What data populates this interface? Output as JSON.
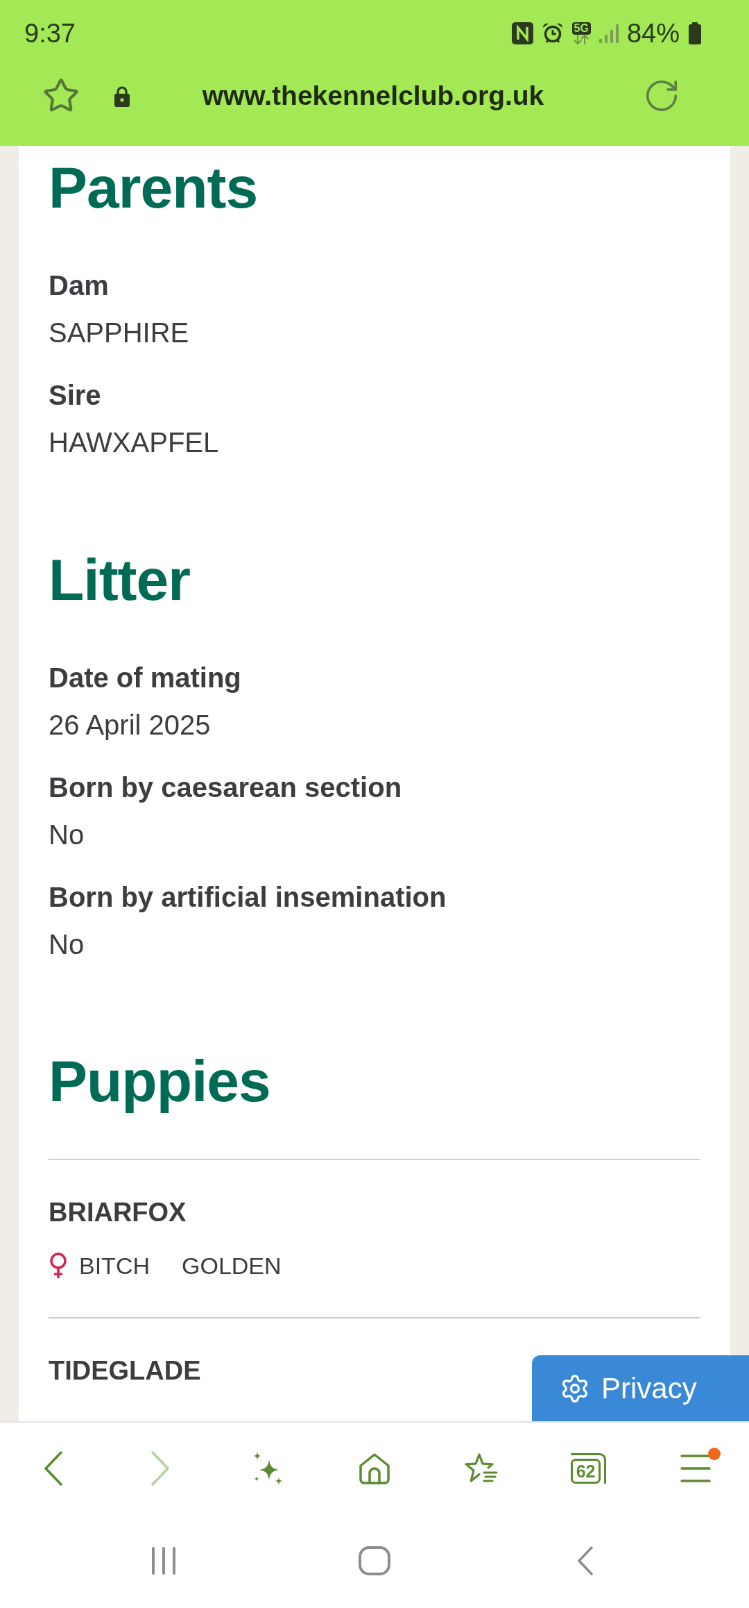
{
  "status_bar": {
    "time": "9:37",
    "network": "5G",
    "battery": "84%"
  },
  "browser_bar": {
    "url": "www.thekennelclub.org.uk"
  },
  "sections": [
    {
      "title": "Parents",
      "fields": [
        {
          "label": "Dam",
          "value": "SAPPHIRE"
        },
        {
          "label": "Sire",
          "value": "HAWXAPFEL"
        }
      ]
    },
    {
      "title": "Litter",
      "fields": [
        {
          "label": "Date of mating",
          "value": "26 April 2025"
        },
        {
          "label": "Born by caesarean section",
          "value": "No"
        },
        {
          "label": "Born by artificial insemination",
          "value": "No"
        }
      ]
    }
  ],
  "puppies": {
    "title": "Puppies",
    "items": [
      {
        "name": "BRIARFOX",
        "kind": "female",
        "sex": "BITCH",
        "colour": "GOLDEN"
      },
      {
        "name": "TIDEGLADE"
      }
    ]
  },
  "privacy_button": {
    "label": "Privacy"
  },
  "toolbar": {
    "buttons": [
      {
        "kind": "back",
        "disabled": false,
        "notification": false
      },
      {
        "kind": "forward",
        "disabled": true,
        "notification": false
      },
      {
        "kind": "sparkle",
        "disabled": false,
        "notification": false
      },
      {
        "kind": "home",
        "disabled": false,
        "notification": false
      },
      {
        "kind": "bookmarks",
        "disabled": false,
        "notification": false
      },
      {
        "kind": "tabs",
        "count": "62",
        "disabled": false,
        "notification": false
      },
      {
        "kind": "menu",
        "disabled": false,
        "notification": true
      }
    ]
  },
  "nav_bar": {
    "buttons": [
      {
        "kind": "recents"
      },
      {
        "kind": "home"
      },
      {
        "kind": "back"
      }
    ]
  }
}
